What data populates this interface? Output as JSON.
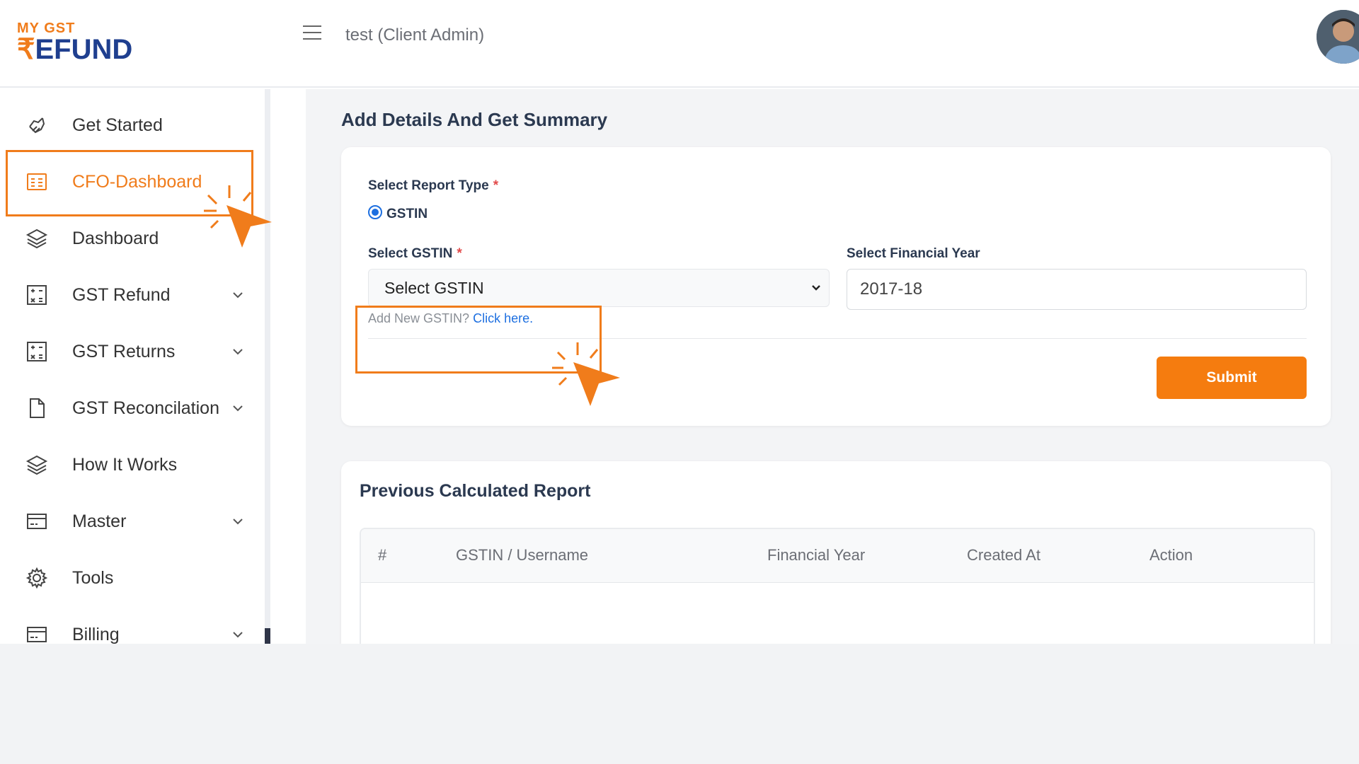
{
  "header": {
    "logo_top": "MY GST",
    "logo_rupee": "₹",
    "logo_bottom": "EFUND",
    "title": "test (Client Admin)"
  },
  "sidebar": {
    "items": [
      {
        "label": "Get Started",
        "icon": "hand-icon"
      },
      {
        "label": "CFO-Dashboard",
        "icon": "dashboard-icon"
      },
      {
        "label": "Dashboard",
        "icon": "layers-icon"
      },
      {
        "label": "GST Refund",
        "icon": "calculator-icon"
      },
      {
        "label": "GST Returns",
        "icon": "calculator-icon"
      },
      {
        "label": "GST Reconcilation",
        "icon": "file-icon"
      },
      {
        "label": "How It Works",
        "icon": "layers-icon"
      },
      {
        "label": "Master",
        "icon": "card-icon"
      },
      {
        "label": "Tools",
        "icon": "gear-icon"
      },
      {
        "label": "Billing",
        "icon": "card-icon"
      }
    ]
  },
  "main": {
    "heading": "Add Details And Get Summary",
    "form": {
      "report_type_label": "Select Report Type",
      "required_mark": "*",
      "report_type_option": "GSTIN",
      "gstin_label": "Select GSTIN",
      "gstin_value": "Select GSTIN",
      "fy_label": "Select Financial Year",
      "fy_value": "2017-18",
      "add_new_text": "Add New GSTIN?",
      "add_new_link": "Click here.",
      "submit_label": "Submit"
    },
    "previous": {
      "title": "Previous Calculated Report",
      "columns": [
        "#",
        "GSTIN / Username",
        "Financial Year",
        "Created At",
        "Action"
      ]
    }
  },
  "colors": {
    "accent": "#f07c1b",
    "brand_blue": "#1f3f8f",
    "link": "#1d6fe0"
  }
}
